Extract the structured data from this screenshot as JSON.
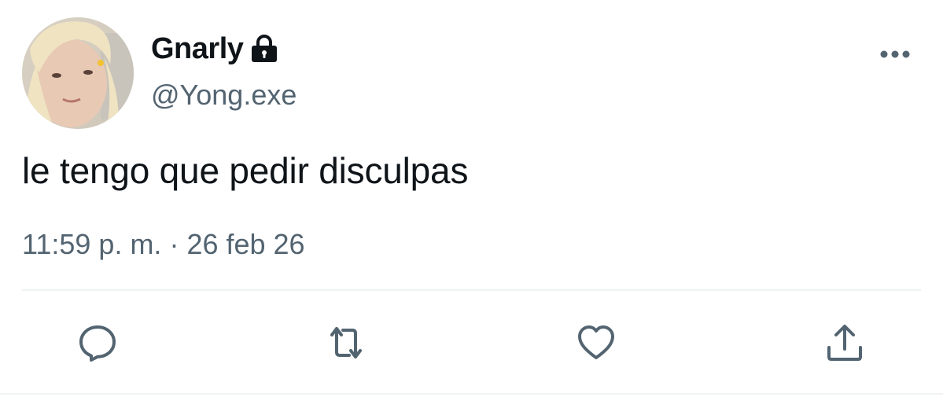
{
  "tweet": {
    "display_name": "Gnarly",
    "protected": true,
    "handle": "@Yong.exe",
    "text": "le tengo que pedir disculpas",
    "time": "11:59 p. m.",
    "separator": "·",
    "date": "26 feb 26"
  },
  "icons": {
    "lock": "lock-icon",
    "more": "more-horizontal-icon",
    "reply": "reply-bubble-icon",
    "retweet": "retweet-icon",
    "like": "heart-icon",
    "share": "share-upload-icon"
  },
  "colors": {
    "text_primary": "#0f1419",
    "text_secondary": "#536471",
    "icon": "#536471",
    "divider": "#eff3f4"
  }
}
